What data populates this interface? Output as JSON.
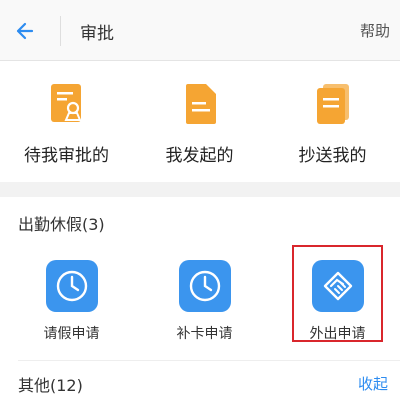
{
  "header": {
    "title": "审批",
    "help_label": "帮助"
  },
  "quick_actions": [
    {
      "label": "待我审批的",
      "icon": "approval-doc-icon"
    },
    {
      "label": "我发起的",
      "icon": "document-icon"
    },
    {
      "label": "抄送我的",
      "icon": "stacked-docs-icon"
    }
  ],
  "sections": {
    "attendance": {
      "title": "出勤休假(3)",
      "apps": [
        {
          "label": "请假申请",
          "icon": "clock-icon"
        },
        {
          "label": "补卡申请",
          "icon": "clock-icon"
        },
        {
          "label": "外出申请",
          "icon": "handshake-icon",
          "highlighted": true
        }
      ]
    },
    "other": {
      "title": "其他(12)",
      "collapse_label": "收起"
    }
  },
  "colors": {
    "accent": "#3b95ee",
    "link": "#2d8cf0",
    "icon_orange": "#f5a533",
    "highlight": "#d9262c"
  }
}
